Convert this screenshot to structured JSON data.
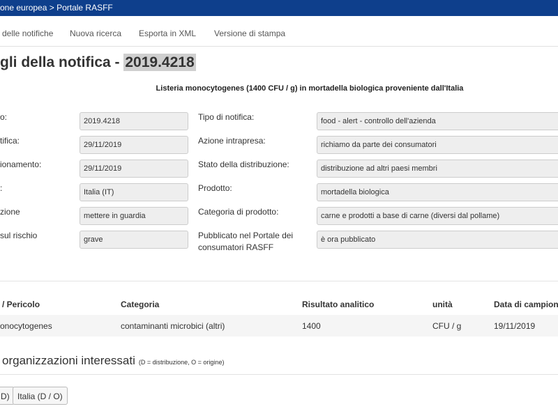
{
  "breadcrumb": "one europea > Portale RASFF",
  "nav": {
    "items": [
      "delle notifiche",
      "Nuova ricerca",
      "Esporta in XML",
      "Versione di stampa"
    ]
  },
  "title": {
    "prefix": "gli della notifica - ",
    "reference": "2019.4218"
  },
  "subtitle": "Listeria monocytogenes (1400 CFU / g) in mortadella biologica proveniente dall'Italia",
  "fields_left": [
    {
      "label": "o:",
      "value": "2019.4218"
    },
    {
      "label": "tifica:",
      "value": "29/11/2019"
    },
    {
      "label": "ionamento:",
      "value": "29/11/2019"
    },
    {
      "label": ":",
      "value": "Italia (IT)"
    },
    {
      "label": "zione",
      "value": "mettere in guardia"
    },
    {
      "label": "sul rischio",
      "value": "grave"
    }
  ],
  "fields_right": [
    {
      "label": "Tipo di notifica:",
      "value": "food - alert - controllo dell'azienda"
    },
    {
      "label": "Azione intrapresa:",
      "value": "richiamo da parte dei consumatori"
    },
    {
      "label": "Stato della distribuzione:",
      "value": "distribuzione ad altri paesi membri"
    },
    {
      "label": "Prodotto:",
      "value": "mortadella biologica"
    },
    {
      "label": "Categoria di prodotto:",
      "value": "carne e prodotti a base di carne (diversi dal pollame)"
    },
    {
      "label_line1": "Pubblicato nel Portale dei",
      "label_line2": "consumatori RASFF",
      "value": "è ora pubblicato"
    }
  ],
  "hazards_table": {
    "headers": [
      "/ Pericolo",
      "Categoria",
      "Risultato analitico",
      "unità",
      "Data di campion"
    ],
    "rows": [
      [
        "onocytogenes",
        "contaminanti microbici (altri)",
        "1400",
        "CFU / g",
        "19/11/2019"
      ]
    ]
  },
  "countries_section": {
    "title": "organizzazioni interessati",
    "legend": "(D = distribuzione, O = origine)",
    "buttons": [
      "D)",
      "Italia (D / O)"
    ]
  },
  "colors": {
    "topbar": "#0e3f8c",
    "field_bg": "#eeeeee",
    "highlight": "#cfcfcf"
  }
}
